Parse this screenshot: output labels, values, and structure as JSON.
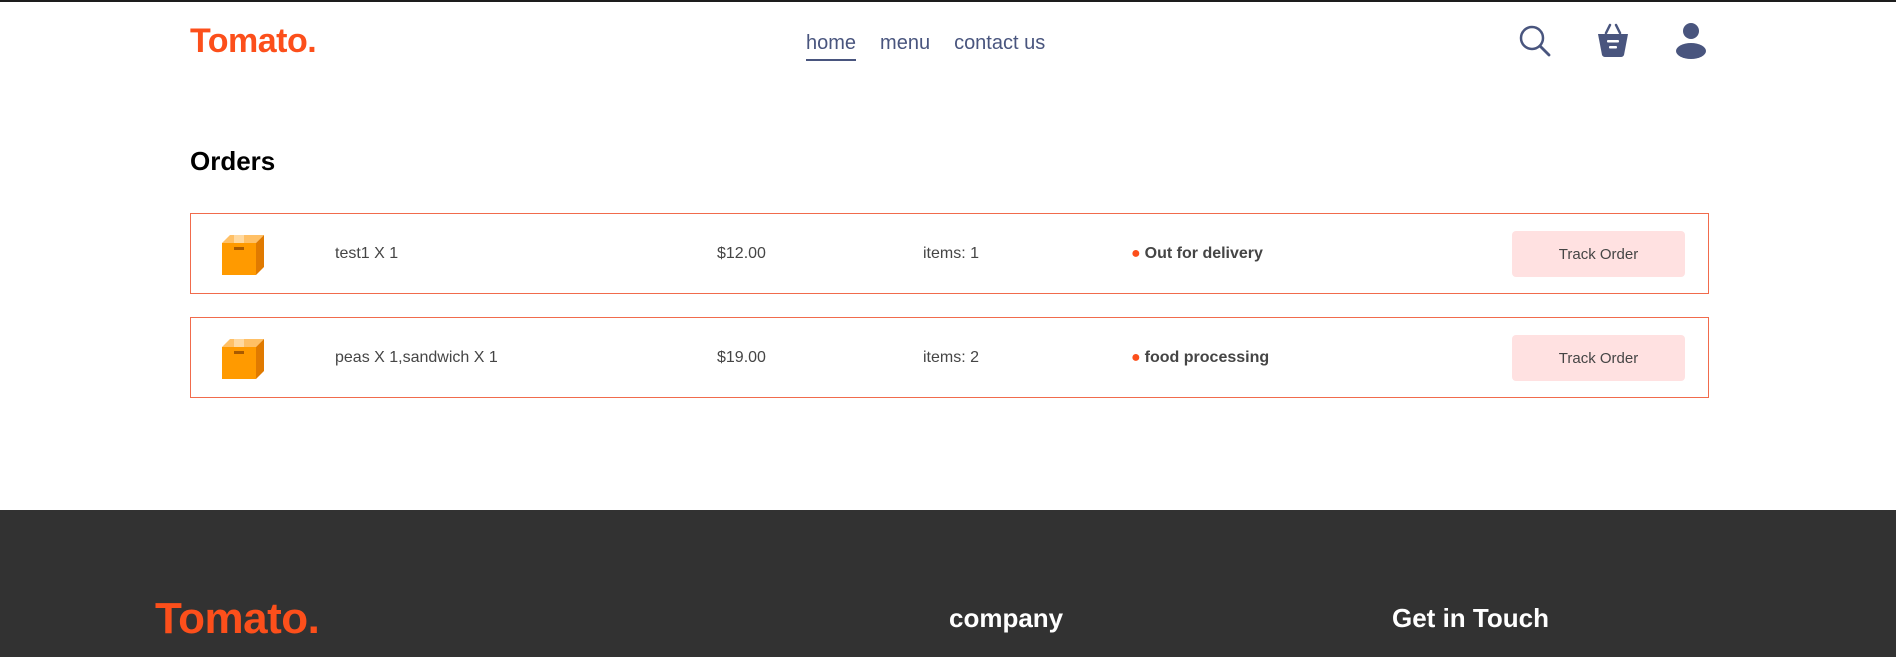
{
  "brand": {
    "logo_text": "Tomato.",
    "accent_color": "#fc4f1b",
    "nav_color": "#49557e"
  },
  "nav": {
    "links": [
      {
        "label": "home",
        "active": true
      },
      {
        "label": "menu",
        "active": false
      },
      {
        "label": "contact us",
        "active": false
      }
    ],
    "icons": [
      "search-icon",
      "basket-icon",
      "profile-icon"
    ]
  },
  "orders": {
    "title": "Orders",
    "rows": [
      {
        "items": "test1 X 1",
        "amount": "$12.00",
        "count": "items: 1",
        "status": "Out for delivery",
        "button": "Track Order"
      },
      {
        "items": "peas X 1,sandwich X 1",
        "amount": "$19.00",
        "count": "items: 2",
        "status": "food processing",
        "button": "Track Order"
      }
    ],
    "status_dot": "●"
  },
  "footer": {
    "logo_text": "Tomato.",
    "company_heading": "company",
    "touch_heading": "Get in Touch",
    "background": "#323232"
  }
}
